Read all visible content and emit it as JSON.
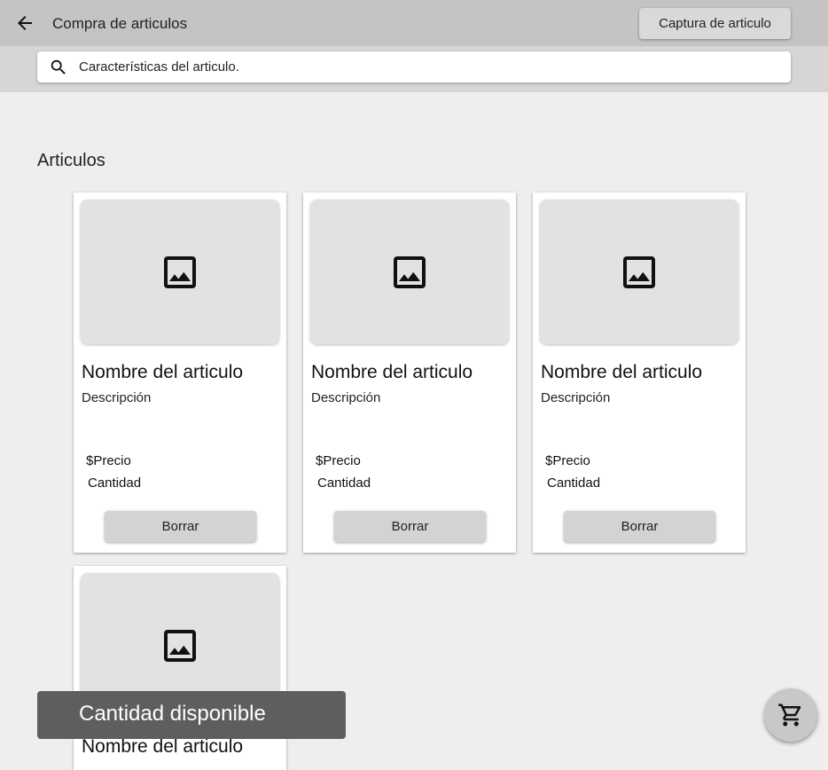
{
  "appbar": {
    "title": "Compra de articulos",
    "capture_button": "Captura de articulo",
    "back_icon": "arrow-left-icon"
  },
  "search": {
    "placeholder": "Características del articulo.",
    "value": "",
    "icon": "search-icon"
  },
  "section_title": "Articulos",
  "items": [
    {
      "name": "Nombre del articulo",
      "description": "Descripción",
      "price": "$Precio",
      "quantity": "Cantidad",
      "delete_label": "Borrar",
      "image_icon": "image-icon"
    },
    {
      "name": "Nombre del articulo",
      "description": "Descripción",
      "price": "$Precio",
      "quantity": "Cantidad",
      "delete_label": "Borrar",
      "image_icon": "image-icon"
    },
    {
      "name": "Nombre del articulo",
      "description": "Descripción",
      "price": "$Precio",
      "quantity": "Cantidad",
      "delete_label": "Borrar",
      "image_icon": "image-icon"
    },
    {
      "name": "Nombre del articulo",
      "image_icon": "image-icon"
    }
  ],
  "toast": {
    "text": "Cantidad disponible"
  },
  "cart_fab": {
    "icon": "shopping-cart-icon"
  },
  "colors": {
    "appbar": "#c4c4c4",
    "searchbar": "#d6d6d6",
    "background": "#eeeeee",
    "toast": "#5e5e5e"
  }
}
